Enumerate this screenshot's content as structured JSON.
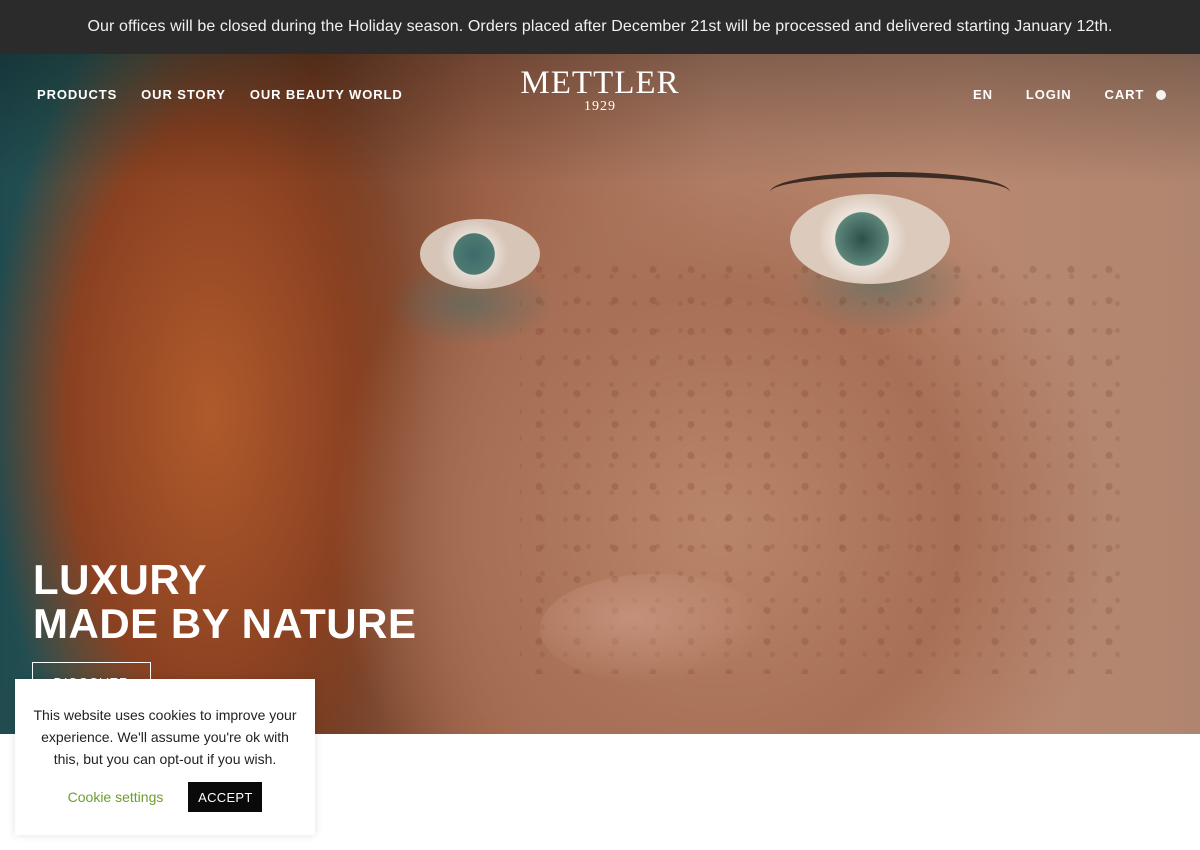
{
  "announcement": {
    "text": "Our offices will be closed during the Holiday season. Orders placed after December 21st will be processed and delivered starting January 12th."
  },
  "nav": {
    "left": [
      {
        "label": "PRODUCTS"
      },
      {
        "label": "OUR STORY"
      },
      {
        "label": "OUR BEAUTY WORLD"
      }
    ],
    "logo": {
      "word": "METTLER",
      "year": "1929"
    },
    "language": "EN",
    "login": "LOGIN",
    "cart": "CART",
    "cart_indicator_icon": "circle-dot-icon"
  },
  "hero": {
    "title_line1": "LUXURY",
    "title_line2": "MADE BY NATURE",
    "cta": "DISCOVER"
  },
  "cookie_banner": {
    "text": "This website uses cookies to improve your experience. We'll assume you're ok with this, but you can opt-out if you wish.",
    "settings_label": "Cookie settings",
    "accept_label": "ACCEPT",
    "settings_color": "#6e9d2f"
  },
  "colors": {
    "announcement_bg": "#2b2b2b",
    "accept_bg": "#0a0a0a"
  }
}
